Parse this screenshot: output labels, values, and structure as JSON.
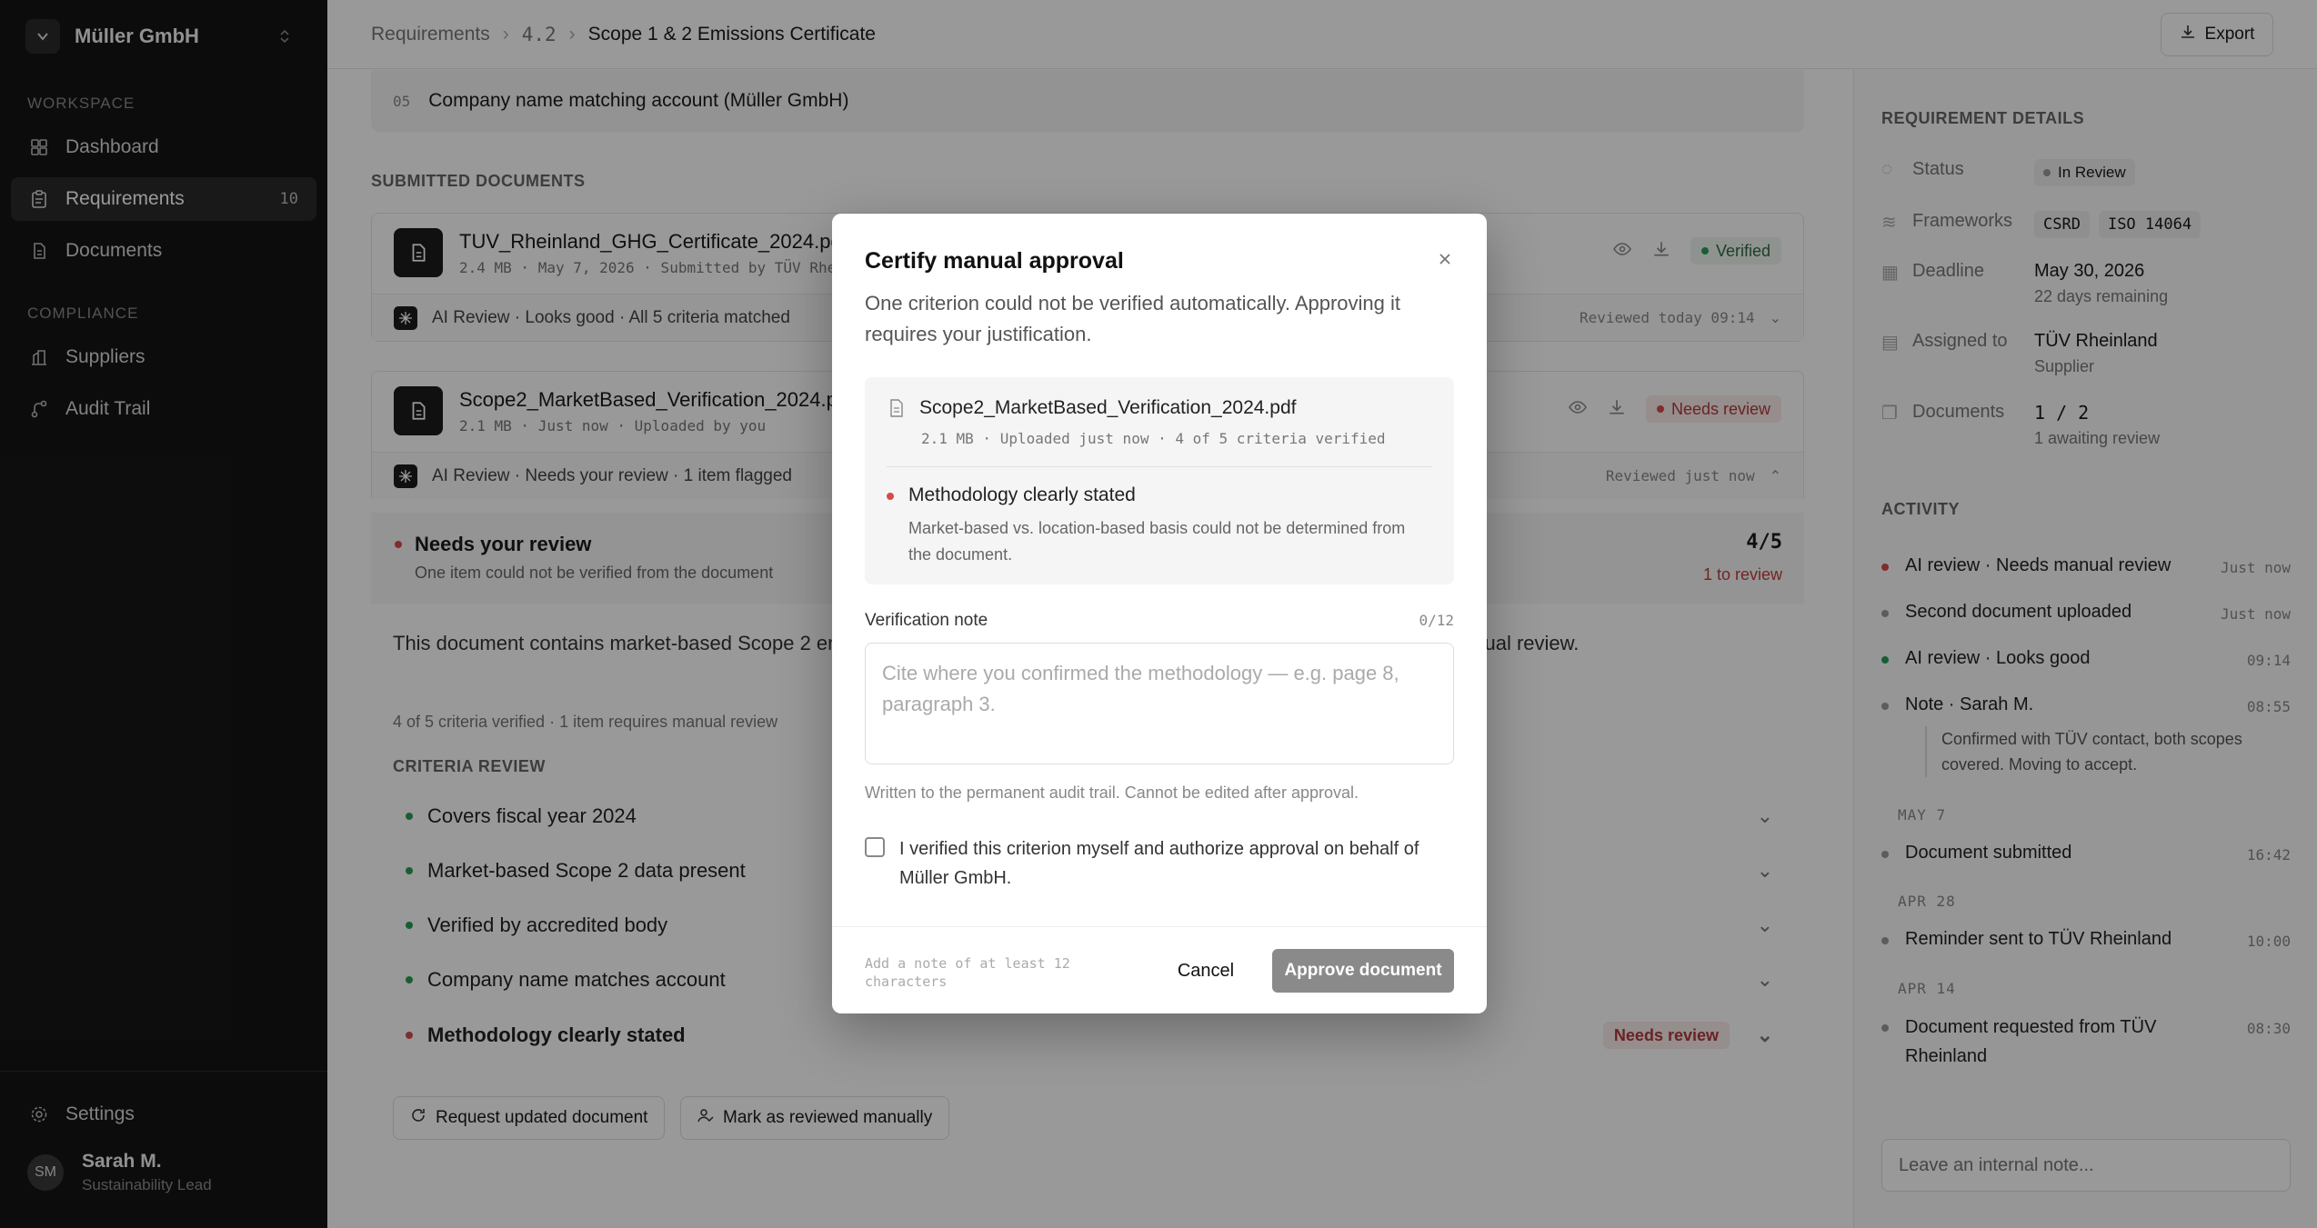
{
  "workspace": {
    "name": "Müller GmbH"
  },
  "sidebar": {
    "workspace_label": "WORKSPACE",
    "compliance_label": "COMPLIANCE",
    "items": [
      {
        "label": "Dashboard",
        "icon": "dashboard-icon"
      },
      {
        "label": "Requirements",
        "icon": "clipboard-icon",
        "count": "10",
        "active": true
      },
      {
        "label": "Documents",
        "icon": "document-icon"
      },
      {
        "label": "Suppliers",
        "icon": "building-icon"
      },
      {
        "label": "Audit Trail",
        "icon": "trail-icon"
      }
    ],
    "settings_label": "Settings",
    "user": {
      "initials": "SM",
      "name": "Sarah M.",
      "role": "Sustainability Lead"
    }
  },
  "header": {
    "breadcrumb": [
      "Requirements",
      "4.2",
      "Scope 1 & 2 Emissions Certificate"
    ],
    "export_label": "Export"
  },
  "main": {
    "criteria_row": {
      "num": "05",
      "label": "Company name matching account (Müller GmbH)"
    },
    "submitted_heading": "SUBMITTED DOCUMENTS",
    "documents": [
      {
        "title": "TUV_Rheinland_GHG_Certificate_2024.pdf",
        "meta": "2.4 MB · May 7, 2026 · Submitted by TÜV Rheinland",
        "status": "Verified",
        "ai_summary": "AI Review · Looks good · All 5 criteria matched",
        "ai_time": "Reviewed today 09:14"
      },
      {
        "title": "Scope2_MarketBased_Verification_2024.pdf",
        "meta": "2.1 MB · Just now · Uploaded by you",
        "status": "Needs review",
        "ai_summary": "AI Review · Needs your review · 1 item flagged",
        "ai_time": "Reviewed just now"
      }
    ],
    "needs": {
      "title": "Needs your review",
      "sub": "One item could not be verified from the document",
      "score": "4/5",
      "to_review": "1 to review"
    },
    "paragraph": "This document contains market-based Scope 2 emissions data. The methodology could not be confirmed and requires manual review.",
    "criteria_summary": "4 of 5 criteria verified · 1 item requires manual review",
    "criteria_heading": "CRITERIA REVIEW",
    "criteria": [
      {
        "label": "Covers fiscal year 2024",
        "status": "ok"
      },
      {
        "label": "Market-based Scope 2 data present",
        "status": "ok"
      },
      {
        "label": "Verified by accredited body",
        "status": "ok"
      },
      {
        "label": "Company name matches account",
        "status": "ok"
      },
      {
        "label": "Methodology clearly stated",
        "status": "review",
        "badge": "Needs review"
      }
    ],
    "request_label": "Request updated document",
    "mark_label": "Mark as reviewed manually"
  },
  "details": {
    "heading": "REQUIREMENT DETAILS",
    "status_key": "Status",
    "status_val": "In Review",
    "frameworks_key": "Frameworks",
    "frameworks": [
      "CSRD",
      "ISO 14064"
    ],
    "deadline_key": "Deadline",
    "deadline_val": "May 30, 2026",
    "deadline_sub": "22 days remaining",
    "assigned_key": "Assigned to",
    "assigned_val": "TÜV Rheinland",
    "assigned_sub": "Supplier",
    "documents_key": "Documents",
    "documents_val": "1 / 2",
    "documents_sub": "1 awaiting review"
  },
  "activity": {
    "heading": "ACTIVITY",
    "items": [
      {
        "label": "AI review · Needs manual review",
        "time": "Just now",
        "color": "r"
      },
      {
        "label": "Second document uploaded",
        "time": "Just now",
        "color": "grey"
      },
      {
        "label": "AI review · Looks good",
        "time": "09:14",
        "color": "g"
      },
      {
        "label": "Note · Sarah M.",
        "time": "08:55",
        "color": "grey"
      },
      {
        "label": "Document submitted",
        "time": "16:42",
        "color": "grey"
      },
      {
        "label": "Reminder sent to TÜV Rheinland",
        "time": "10:00",
        "color": "grey"
      },
      {
        "label": "Document requested from TÜV Rheinland",
        "time": "08:30",
        "color": "grey"
      }
    ],
    "note_text": "Confirmed with TÜV contact, both scopes covered. Moving to accept.",
    "dates": [
      "MAY 7",
      "APR 28",
      "APR 14"
    ],
    "note_placeholder": "Leave an internal note..."
  },
  "modal": {
    "title": "Certify manual approval",
    "description": "One criterion could not be verified automatically. Approving it requires your justification.",
    "file_name": "Scope2_MarketBased_Verification_2024.pdf",
    "file_meta": "2.1 MB · Uploaded just now · 4 of 5 criteria verified",
    "criterion": "Methodology clearly stated",
    "criterion_detail": "Market-based vs. location-based basis could not be determined from the document.",
    "note_label": "Verification note",
    "note_count": "0/12",
    "note_placeholder": "Cite where you confirmed the methodology — e.g. page 8, paragraph 3.",
    "help": "Written to the permanent audit trail. Cannot be edited after approval.",
    "checkbox_label": "I verified this criterion myself and authorize approval on behalf of Müller GmbH.",
    "footer_hint": "Add a note of at least 12 characters",
    "cancel_label": "Cancel",
    "approve_label": "Approve document"
  }
}
